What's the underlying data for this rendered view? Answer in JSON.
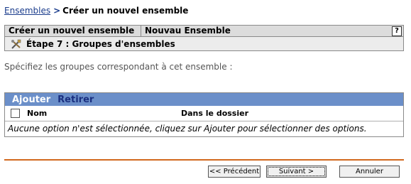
{
  "breadcrumb": {
    "link": "Ensembles",
    "separator": ">",
    "current": "Créer un nouvel ensemble"
  },
  "wizard": {
    "title_left": "Créer un nouvel ensemble",
    "title_right": "Nouvau Ensemble",
    "help": "?",
    "step": "Étape 7 : Groupes d'ensembles",
    "step_icon": "wizard-tools-icon"
  },
  "instructions": "Spécifiez les groupes correspondant à cet ensemble :",
  "groups": {
    "add_label": "Ajouter",
    "remove_label": "Retirer",
    "col_name": "Nom",
    "col_folder": "Dans le dossier",
    "empty_message": "Aucune option n'est sélectionnée, cliquez sur Ajouter pour sélectionner des options."
  },
  "buttons": {
    "previous": "<< Précédent",
    "next": "Suivant >",
    "cancel": "Annuler"
  },
  "colors": {
    "link": "#1a3c8c",
    "bar": "#6b8fc9",
    "rule": "#d2691e"
  }
}
